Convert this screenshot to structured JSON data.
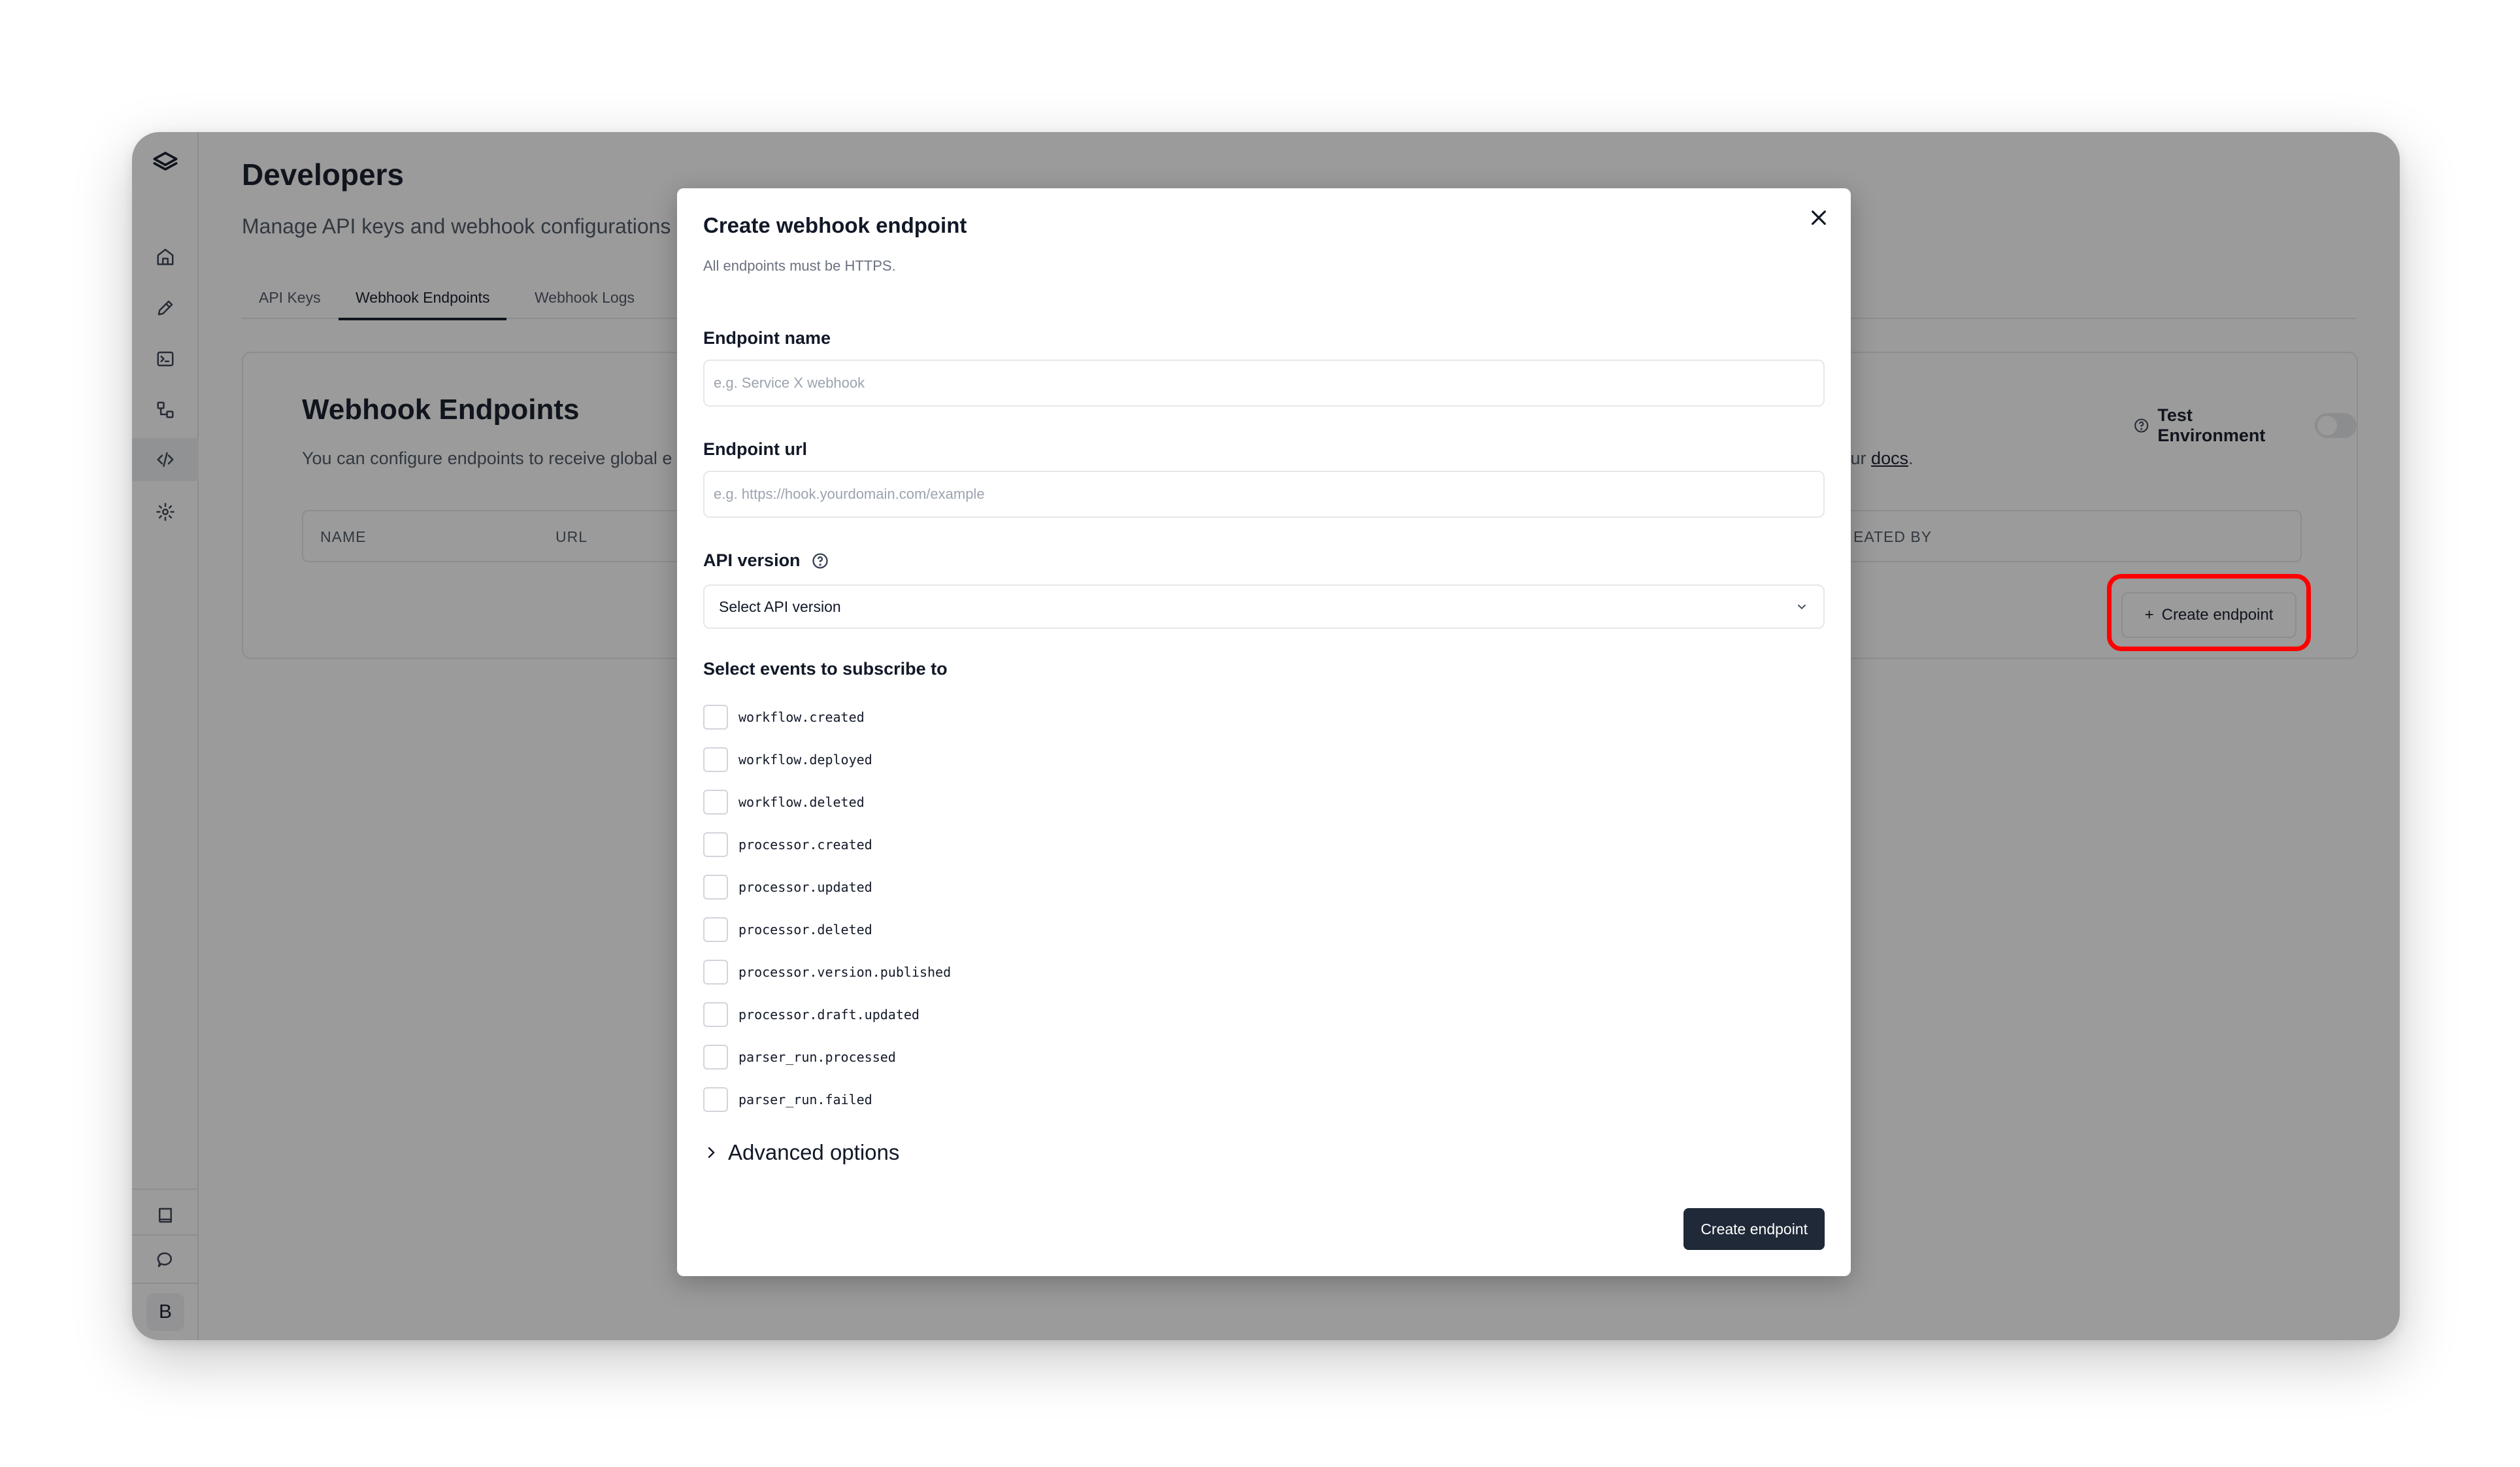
{
  "app": {
    "page_title": "Developers",
    "page_subtitle": "Manage API keys and webhook configurations",
    "avatar_initial": "B"
  },
  "sidebar": {
    "items": [
      {
        "icon": "layers-logo-icon"
      },
      {
        "icon": "home-icon"
      },
      {
        "icon": "pencil-icon"
      },
      {
        "icon": "terminal-icon"
      },
      {
        "icon": "workflow-icon"
      },
      {
        "icon": "code-icon",
        "active": true
      },
      {
        "icon": "gear-icon"
      }
    ],
    "bottom": [
      {
        "icon": "book-icon"
      },
      {
        "icon": "chat-icon"
      }
    ]
  },
  "tabs": [
    {
      "label": "API Keys"
    },
    {
      "label": "Webhook Endpoints",
      "active": true
    },
    {
      "label": "Webhook Logs"
    }
  ],
  "card": {
    "title": "Webhook Endpoints",
    "description": "You can configure endpoints to receive global e",
    "description_tail": "e our ",
    "docs_link": "docs",
    "description_end": ".",
    "test_env_label": "Test Environment",
    "test_env_on": false,
    "columns": [
      "NAME",
      "URL",
      "EATED BY"
    ],
    "create_button": "Create endpoint"
  },
  "modal": {
    "title": "Create webhook endpoint",
    "subtitle": "All endpoints must be HTTPS.",
    "name_label": "Endpoint name",
    "name_placeholder": "e.g. Service X webhook",
    "url_label": "Endpoint url",
    "url_placeholder": "e.g. https://hook.yourdomain.com/example",
    "api_version_label": "API version",
    "api_version_value": "Select API version",
    "events_label": "Select events to subscribe to",
    "events": [
      "workflow.created",
      "workflow.deployed",
      "workflow.deleted",
      "processor.created",
      "processor.updated",
      "processor.deleted",
      "processor.version.published",
      "processor.draft.updated",
      "parser_run.processed",
      "parser_run.failed"
    ],
    "advanced_label": "Advanced options",
    "submit_label": "Create endpoint"
  },
  "colors": {
    "highlight": "#ff0000",
    "primary": "#1f2937",
    "overlay": "rgba(17,17,17,0.42)"
  }
}
